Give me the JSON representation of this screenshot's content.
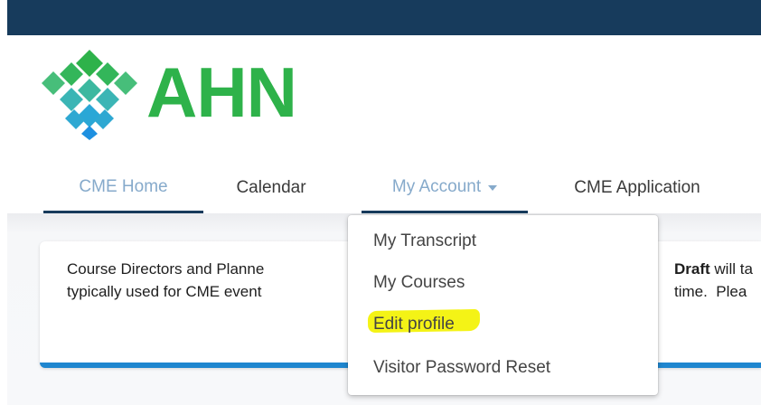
{
  "brand": {
    "name": "AHN",
    "colors": {
      "top_bar": "#173b5c",
      "logo_green": "#2eb24a",
      "nav_active": "#86aacb",
      "accent_blue": "#1f86cf",
      "highlight_yellow": "#f3f20a"
    }
  },
  "nav": {
    "items": [
      {
        "label": "CME Home",
        "state": "active"
      },
      {
        "label": "Calendar",
        "state": "normal"
      },
      {
        "label": "My Account",
        "state": "open-dropdown"
      },
      {
        "label": "CME Application",
        "state": "normal"
      }
    ]
  },
  "account_menu": {
    "items": [
      {
        "label": "My Transcript"
      },
      {
        "label": "My Courses"
      },
      {
        "label": "Edit profile",
        "highlighted": true
      },
      {
        "label": "Visitor Password Reset"
      }
    ]
  },
  "notice": {
    "line1_left": "Course Directors and Planne",
    "line1_right_bold": "Draft",
    "line1_right": " will ta",
    "line2_left": "typically used for CME event",
    "line2_right": "time.  Plea"
  }
}
